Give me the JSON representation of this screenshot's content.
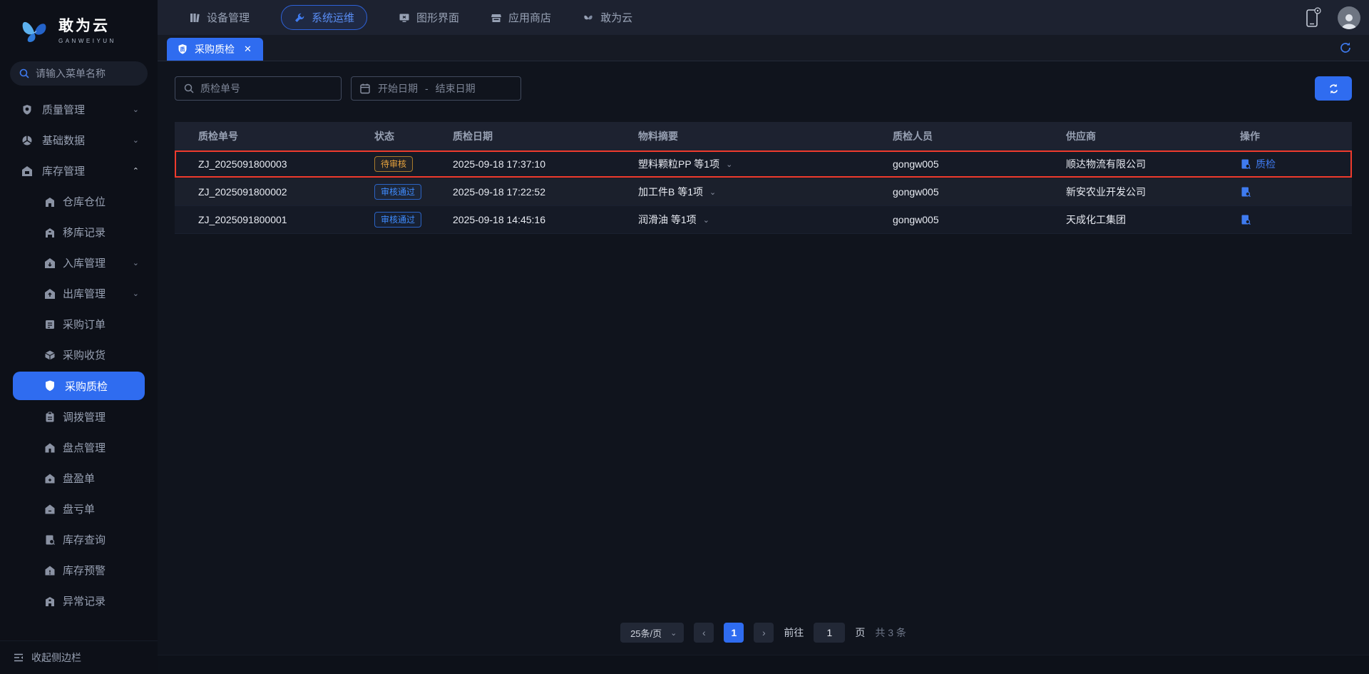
{
  "brand": {
    "name": "敢为云",
    "subtitle": "GANWEIYUN"
  },
  "sidebar": {
    "search_placeholder": "请输入菜单名称",
    "groups": [
      {
        "label": "质量管理",
        "expanded": false
      },
      {
        "label": "基础数据",
        "expanded": false
      },
      {
        "label": "库存管理",
        "expanded": true,
        "children": [
          {
            "label": "仓库仓位"
          },
          {
            "label": "移库记录"
          },
          {
            "label": "入库管理",
            "expandable": true
          },
          {
            "label": "出库管理",
            "expandable": true
          },
          {
            "label": "采购订单"
          },
          {
            "label": "采购收货"
          },
          {
            "label": "采购质检",
            "active": true
          },
          {
            "label": "调拨管理"
          },
          {
            "label": "盘点管理"
          },
          {
            "label": "盘盈单"
          },
          {
            "label": "盘亏单"
          },
          {
            "label": "库存查询"
          },
          {
            "label": "库存预警"
          },
          {
            "label": "异常记录"
          }
        ]
      }
    ],
    "collapse_label": "收起侧边栏"
  },
  "topnav": {
    "items": [
      {
        "label": "设备管理",
        "active": false
      },
      {
        "label": "系统运维",
        "active": true
      },
      {
        "label": "图形界面",
        "active": false
      },
      {
        "label": "应用商店",
        "active": false
      },
      {
        "label": "敢为云",
        "active": false
      }
    ]
  },
  "tabs": [
    {
      "label": "采购质检",
      "active": true,
      "closable": true
    }
  ],
  "toolbar": {
    "keyword_placeholder": "质检单号",
    "date_start_placeholder": "开始日期",
    "date_separator": "-",
    "date_end_placeholder": "结束日期"
  },
  "table": {
    "columns": [
      "质检单号",
      "状态",
      "质检日期",
      "物料摘要",
      "质检人员",
      "供应商",
      "操作"
    ],
    "rows": [
      {
        "id": "ZJ_2025091800003",
        "status": "待审核",
        "status_type": "warning",
        "date": "2025-09-18 17:37:10",
        "material": "塑料颗粒PP 等1项",
        "inspector": "gongw005",
        "supplier": "顺达物流有限公司",
        "action_label": "质检",
        "highlighted": true
      },
      {
        "id": "ZJ_2025091800002",
        "status": "审核通过",
        "status_type": "primary",
        "date": "2025-09-18 17:22:52",
        "material": "加工件B 等1项",
        "inspector": "gongw005",
        "supplier": "新安农业开发公司",
        "action_label": "",
        "highlighted": false
      },
      {
        "id": "ZJ_2025091800001",
        "status": "审核通过",
        "status_type": "primary",
        "date": "2025-09-18 14:45:16",
        "material": "润滑油 等1项",
        "inspector": "gongw005",
        "supplier": "天成化工集团",
        "action_label": "",
        "highlighted": false
      }
    ]
  },
  "pagination": {
    "page_size": "25条/页",
    "prev": "‹",
    "next": "›",
    "current_page": "1",
    "goto_label": "前往",
    "goto_value": "1",
    "page_unit": "页",
    "total": "共 3 条"
  },
  "colors": {
    "accent": "#2f6cf0",
    "warning": "#e6a23c",
    "link": "#3f8cff",
    "highlight_border": "#ef3b2d"
  }
}
